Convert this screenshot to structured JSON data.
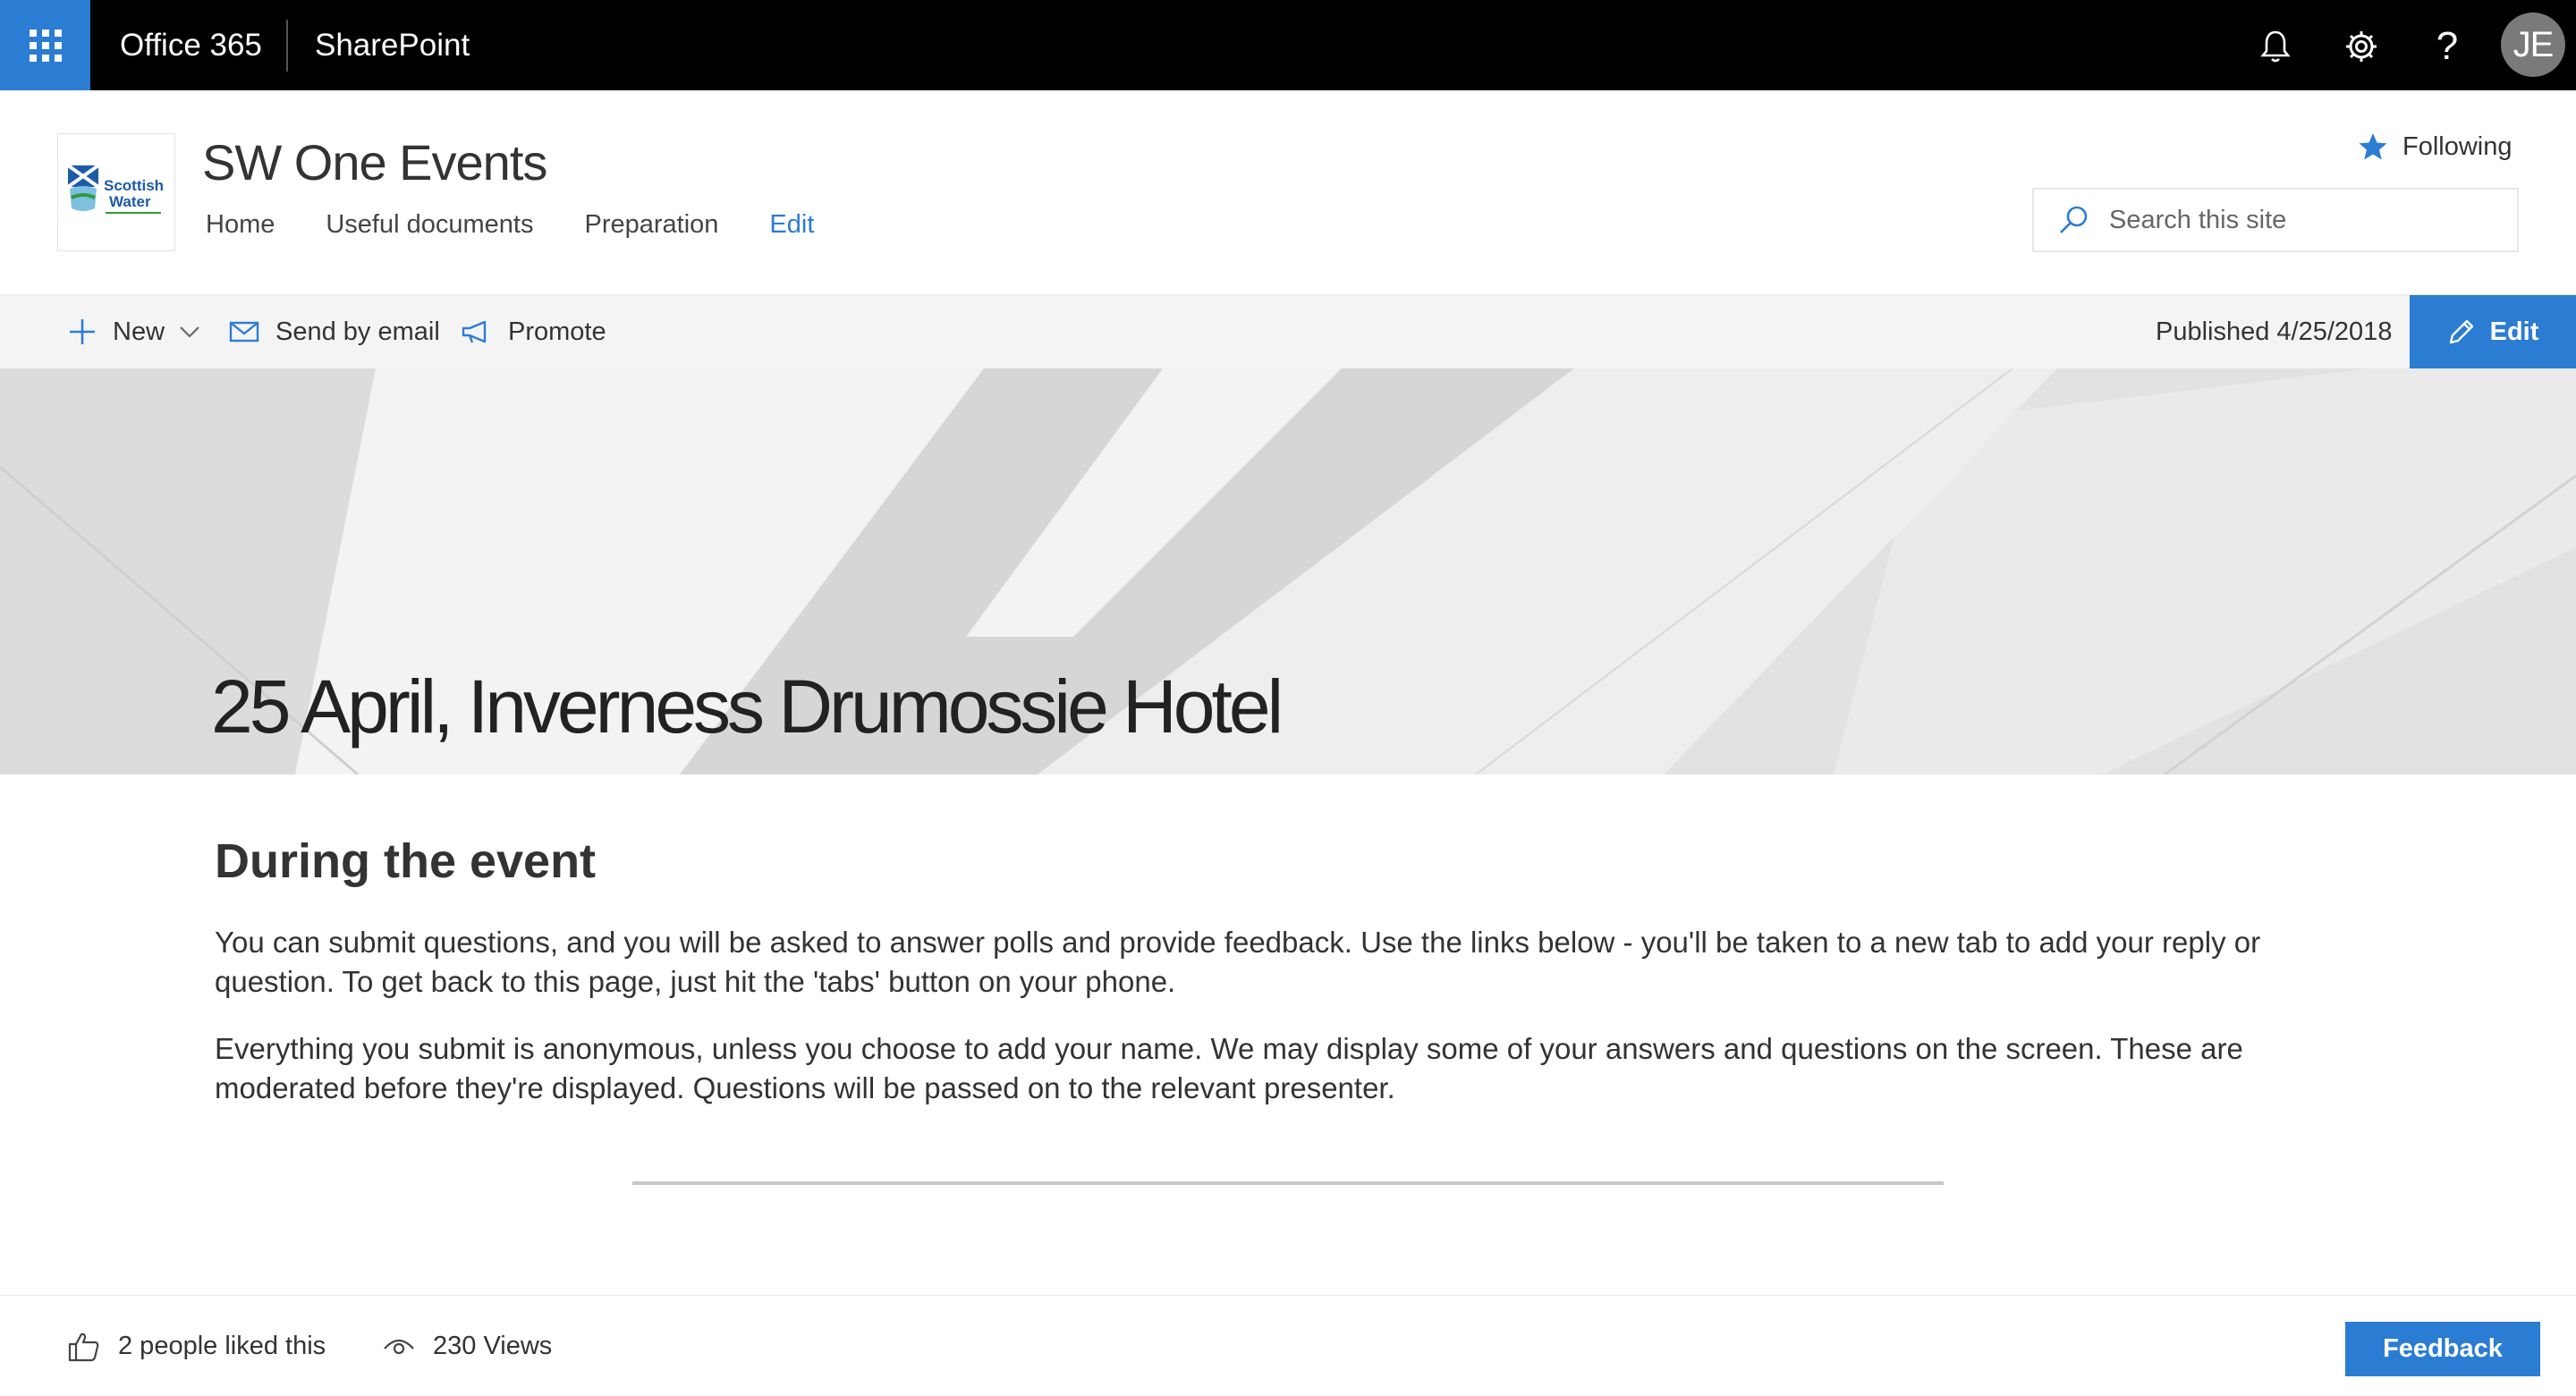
{
  "suite_bar": {
    "brand": "Office 365",
    "app_name": "SharePoint",
    "avatar_initials": "JE",
    "icons": [
      "app-launcher-icon",
      "bell-icon",
      "gear-icon",
      "help-icon"
    ],
    "accent_color": "#2b7cd3"
  },
  "site": {
    "logo_text_line1": "Scottish",
    "logo_text_line2": "Water",
    "title": "SW One Events",
    "nav": [
      {
        "label": "Home"
      },
      {
        "label": "Useful documents"
      },
      {
        "label": "Preparation"
      },
      {
        "label": "Edit"
      }
    ],
    "following_label": "Following",
    "search_placeholder": "Search this site"
  },
  "command_bar": {
    "new_label": "New",
    "send_email_label": "Send by email",
    "promote_label": "Promote",
    "published_text": "Published 4/25/2018",
    "edit_label": "Edit"
  },
  "hero": {
    "title": "25 April, Inverness Drumossie Hotel"
  },
  "article": {
    "heading": "During the event",
    "paragraphs": [
      "You can submit questions, and you will be asked to answer polls and provide feedback. Use the links below - you'll be taken to a new tab to add your reply or question. To get back to this page, just hit the 'tabs' button on your phone.",
      "Everything you submit is anonymous, unless you choose to add your name. We may display some of your answers and questions on the screen. These are moderated before they're displayed. Questions will be passed on to the relevant presenter."
    ]
  },
  "footer": {
    "likes_text": "2 people liked this",
    "views_text": "230 Views",
    "feedback_label": "Feedback"
  }
}
